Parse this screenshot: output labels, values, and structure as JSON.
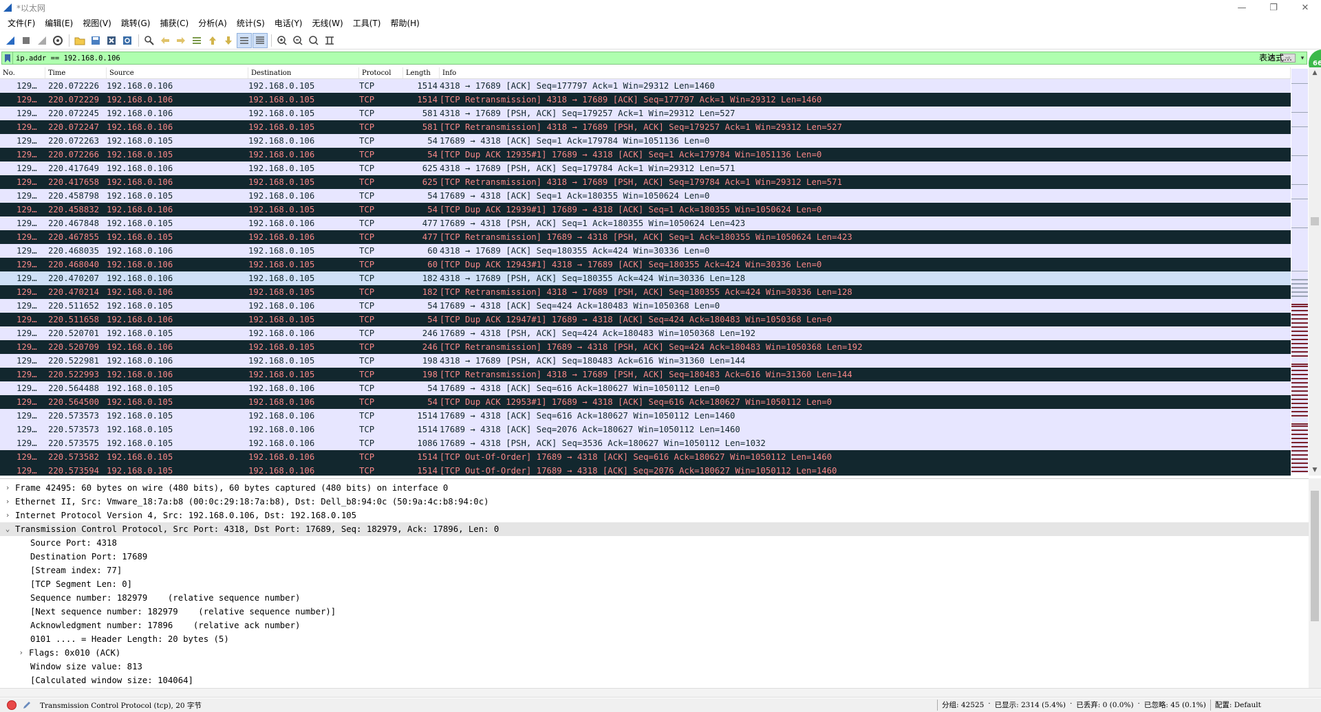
{
  "window": {
    "title": "*以太网",
    "minimize": "—",
    "restore": "❐",
    "close": "✕"
  },
  "menu": [
    "文件(F)",
    "编辑(E)",
    "视图(V)",
    "跳转(G)",
    "捕获(C)",
    "分析(A)",
    "统计(S)",
    "电话(Y)",
    "无线(W)",
    "工具(T)",
    "帮助(H)"
  ],
  "toolbar": {
    "icons": [
      "shark-fin-start-icon",
      "stop-square-icon",
      "restart-fin-icon",
      "capture-options-gear-icon",
      "open-folder-icon",
      "save-file-icon",
      "close-file-x-icon",
      "reload-icon",
      "find-magnifier-icon",
      "go-back-arrow-icon",
      "go-forward-arrow-icon",
      "go-to-packet-icon",
      "first-packet-icon",
      "last-packet-icon",
      "autoscroll-icon",
      "colorize-icon",
      "zoom-in-icon",
      "zoom-out-icon",
      "zoom-normal-icon",
      "resize-columns-icon"
    ]
  },
  "filter": {
    "value": "ip.addr == 192.168.0.106",
    "expression_label": "表达式…",
    "badge": "66"
  },
  "packet_list": {
    "columns": [
      "No.",
      "Time",
      "Source",
      "Destination",
      "Protocol",
      "Length",
      "Info"
    ],
    "rows": [
      {
        "no": "129…",
        "time": "220.072226",
        "src": "192.168.0.106",
        "dst": "192.168.0.105",
        "proto": "TCP",
        "len": "1514",
        "info": "4318 → 17689 [ACK] Seq=177797 Ack=1 Win=29312 Len=1460",
        "style": "normal"
      },
      {
        "no": "129…",
        "time": "220.072229",
        "src": "192.168.0.106",
        "dst": "192.168.0.105",
        "proto": "TCP",
        "len": "1514",
        "info": "[TCP Retransmission] 4318 → 17689 [ACK] Seq=177797 Ack=1 Win=29312 Len=1460",
        "style": "bad"
      },
      {
        "no": "129…",
        "time": "220.072245",
        "src": "192.168.0.106",
        "dst": "192.168.0.105",
        "proto": "TCP",
        "len": "581",
        "info": "4318 → 17689 [PSH, ACK] Seq=179257 Ack=1 Win=29312 Len=527",
        "style": "normal"
      },
      {
        "no": "129…",
        "time": "220.072247",
        "src": "192.168.0.106",
        "dst": "192.168.0.105",
        "proto": "TCP",
        "len": "581",
        "info": "[TCP Retransmission] 4318 → 17689 [PSH, ACK] Seq=179257 Ack=1 Win=29312 Len=527",
        "style": "bad"
      },
      {
        "no": "129…",
        "time": "220.072263",
        "src": "192.168.0.105",
        "dst": "192.168.0.106",
        "proto": "TCP",
        "len": "54",
        "info": "17689 → 4318 [ACK] Seq=1 Ack=179784 Win=1051136 Len=0",
        "style": "normal"
      },
      {
        "no": "129…",
        "time": "220.072266",
        "src": "192.168.0.105",
        "dst": "192.168.0.106",
        "proto": "TCP",
        "len": "54",
        "info": "[TCP Dup ACK 12935#1] 17689 → 4318 [ACK] Seq=1 Ack=179784 Win=1051136 Len=0",
        "style": "bad"
      },
      {
        "no": "129…",
        "time": "220.417649",
        "src": "192.168.0.106",
        "dst": "192.168.0.105",
        "proto": "TCP",
        "len": "625",
        "info": "4318 → 17689 [PSH, ACK] Seq=179784 Ack=1 Win=29312 Len=571",
        "style": "normal"
      },
      {
        "no": "129…",
        "time": "220.417658",
        "src": "192.168.0.106",
        "dst": "192.168.0.105",
        "proto": "TCP",
        "len": "625",
        "info": "[TCP Retransmission] 4318 → 17689 [PSH, ACK] Seq=179784 Ack=1 Win=29312 Len=571",
        "style": "bad"
      },
      {
        "no": "129…",
        "time": "220.458798",
        "src": "192.168.0.105",
        "dst": "192.168.0.106",
        "proto": "TCP",
        "len": "54",
        "info": "17689 → 4318 [ACK] Seq=1 Ack=180355 Win=1050624 Len=0",
        "style": "normal"
      },
      {
        "no": "129…",
        "time": "220.458832",
        "src": "192.168.0.106",
        "dst": "192.168.0.105",
        "proto": "TCP",
        "len": "54",
        "info": "[TCP Dup ACK 12939#1] 17689 → 4318 [ACK] Seq=1 Ack=180355 Win=1050624 Len=0",
        "style": "bad"
      },
      {
        "no": "129…",
        "time": "220.467848",
        "src": "192.168.0.105",
        "dst": "192.168.0.106",
        "proto": "TCP",
        "len": "477",
        "info": "17689 → 4318 [PSH, ACK] Seq=1 Ack=180355 Win=1050624 Len=423",
        "style": "normal"
      },
      {
        "no": "129…",
        "time": "220.467855",
        "src": "192.168.0.105",
        "dst": "192.168.0.106",
        "proto": "TCP",
        "len": "477",
        "info": "[TCP Retransmission] 17689 → 4318 [PSH, ACK] Seq=1 Ack=180355 Win=1050624 Len=423",
        "style": "bad"
      },
      {
        "no": "129…",
        "time": "220.468035",
        "src": "192.168.0.106",
        "dst": "192.168.0.105",
        "proto": "TCP",
        "len": "60",
        "info": "4318 → 17689 [ACK] Seq=180355 Ack=424 Win=30336 Len=0",
        "style": "normal"
      },
      {
        "no": "129…",
        "time": "220.468040",
        "src": "192.168.0.106",
        "dst": "192.168.0.105",
        "proto": "TCP",
        "len": "60",
        "info": "[TCP Dup ACK 12943#1] 4318 → 17689 [ACK] Seq=180355 Ack=424 Win=30336 Len=0",
        "style": "bad"
      },
      {
        "no": "129…",
        "time": "220.470207",
        "src": "192.168.0.106",
        "dst": "192.168.0.105",
        "proto": "TCP",
        "len": "182",
        "info": "4318 → 17689 [PSH, ACK] Seq=180355 Ack=424 Win=30336 Len=128",
        "style": "normal sel"
      },
      {
        "no": "129…",
        "time": "220.470214",
        "src": "192.168.0.106",
        "dst": "192.168.0.105",
        "proto": "TCP",
        "len": "182",
        "info": "[TCP Retransmission] 4318 → 17689 [PSH, ACK] Seq=180355 Ack=424 Win=30336 Len=128",
        "style": "bad"
      },
      {
        "no": "129…",
        "time": "220.511652",
        "src": "192.168.0.105",
        "dst": "192.168.0.106",
        "proto": "TCP",
        "len": "54",
        "info": "17689 → 4318 [ACK] Seq=424 Ack=180483 Win=1050368 Len=0",
        "style": "normal"
      },
      {
        "no": "129…",
        "time": "220.511658",
        "src": "192.168.0.106",
        "dst": "192.168.0.105",
        "proto": "TCP",
        "len": "54",
        "info": "[TCP Dup ACK 12947#1] 17689 → 4318 [ACK] Seq=424 Ack=180483 Win=1050368 Len=0",
        "style": "bad"
      },
      {
        "no": "129…",
        "time": "220.520701",
        "src": "192.168.0.105",
        "dst": "192.168.0.106",
        "proto": "TCP",
        "len": "246",
        "info": "17689 → 4318 [PSH, ACK] Seq=424 Ack=180483 Win=1050368 Len=192",
        "style": "normal"
      },
      {
        "no": "129…",
        "time": "220.520709",
        "src": "192.168.0.106",
        "dst": "192.168.0.105",
        "proto": "TCP",
        "len": "246",
        "info": "[TCP Retransmission] 17689 → 4318 [PSH, ACK] Seq=424 Ack=180483 Win=1050368 Len=192",
        "style": "bad"
      },
      {
        "no": "129…",
        "time": "220.522981",
        "src": "192.168.0.106",
        "dst": "192.168.0.105",
        "proto": "TCP",
        "len": "198",
        "info": "4318 → 17689 [PSH, ACK] Seq=180483 Ack=616 Win=31360 Len=144",
        "style": "normal"
      },
      {
        "no": "129…",
        "time": "220.522993",
        "src": "192.168.0.106",
        "dst": "192.168.0.105",
        "proto": "TCP",
        "len": "198",
        "info": "[TCP Retransmission] 4318 → 17689 [PSH, ACK] Seq=180483 Ack=616 Win=31360 Len=144",
        "style": "bad"
      },
      {
        "no": "129…",
        "time": "220.564488",
        "src": "192.168.0.105",
        "dst": "192.168.0.106",
        "proto": "TCP",
        "len": "54",
        "info": "17689 → 4318 [ACK] Seq=616 Ack=180627 Win=1050112 Len=0",
        "style": "normal"
      },
      {
        "no": "129…",
        "time": "220.564500",
        "src": "192.168.0.105",
        "dst": "192.168.0.106",
        "proto": "TCP",
        "len": "54",
        "info": "[TCP Dup ACK 12953#1] 17689 → 4318 [ACK] Seq=616 Ack=180627 Win=1050112 Len=0",
        "style": "bad"
      },
      {
        "no": "129…",
        "time": "220.573573",
        "src": "192.168.0.105",
        "dst": "192.168.0.106",
        "proto": "TCP",
        "len": "1514",
        "info": "17689 → 4318 [ACK] Seq=616 Ack=180627 Win=1050112 Len=1460",
        "style": "normal"
      },
      {
        "no": "129…",
        "time": "220.573573",
        "src": "192.168.0.105",
        "dst": "192.168.0.106",
        "proto": "TCP",
        "len": "1514",
        "info": "17689 → 4318 [ACK] Seq=2076 Ack=180627 Win=1050112 Len=1460",
        "style": "normal"
      },
      {
        "no": "129…",
        "time": "220.573575",
        "src": "192.168.0.105",
        "dst": "192.168.0.106",
        "proto": "TCP",
        "len": "1086",
        "info": "17689 → 4318 [PSH, ACK] Seq=3536 Ack=180627 Win=1050112 Len=1032",
        "style": "normal"
      },
      {
        "no": "129…",
        "time": "220.573582",
        "src": "192.168.0.105",
        "dst": "192.168.0.106",
        "proto": "TCP",
        "len": "1514",
        "info": "[TCP Out-Of-Order] 17689 → 4318 [ACK] Seq=616 Ack=180627 Win=1050112 Len=1460",
        "style": "bad"
      },
      {
        "no": "129…",
        "time": "220.573594",
        "src": "192.168.0.105",
        "dst": "192.168.0.106",
        "proto": "TCP",
        "len": "1514",
        "info": "[TCP Out-Of-Order] 17689 → 4318 [ACK] Seq=2076 Ack=180627 Win=1050112 Len=1460",
        "style": "bad"
      }
    ]
  },
  "detail": {
    "rows": [
      {
        "text": "Frame 42495: 60 bytes on wire (480 bits), 60 bytes captured (480 bits) on interface 0",
        "level": 0,
        "arrow": "›"
      },
      {
        "text": "Ethernet II, Src: Vmware_18:7a:b8 (00:0c:29:18:7a:b8), Dst: Dell_b8:94:0c (50:9a:4c:b8:94:0c)",
        "level": 0,
        "arrow": "›"
      },
      {
        "text": "Internet Protocol Version 4, Src: 192.168.0.106, Dst: 192.168.0.105",
        "level": 0,
        "arrow": "›"
      },
      {
        "text": "Transmission Control Protocol, Src Port: 4318, Dst Port: 17689, Seq: 182979, Ack: 17896, Len: 0",
        "level": 0,
        "arrow": "⌄",
        "selected": true
      },
      {
        "text": "Source Port: 4318",
        "level": 1,
        "arrow": ""
      },
      {
        "text": "Destination Port: 17689",
        "level": 1,
        "arrow": ""
      },
      {
        "text": "[Stream index: 77]",
        "level": 1,
        "arrow": ""
      },
      {
        "text": "[TCP Segment Len: 0]",
        "level": 1,
        "arrow": ""
      },
      {
        "text": "Sequence number: 182979    (relative sequence number)",
        "level": 1,
        "arrow": ""
      },
      {
        "text": "[Next sequence number: 182979    (relative sequence number)]",
        "level": 1,
        "arrow": ""
      },
      {
        "text": "Acknowledgment number: 17896    (relative ack number)",
        "level": 1,
        "arrow": ""
      },
      {
        "text": "0101 .... = Header Length: 20 bytes (5)",
        "level": 1,
        "arrow": ""
      },
      {
        "text": "Flags: 0x010 (ACK)",
        "level": 1,
        "arrow": "›"
      },
      {
        "text": "Window size value: 813",
        "level": 1,
        "arrow": ""
      },
      {
        "text": "[Calculated window size: 104064]",
        "level": 1,
        "arrow": ""
      }
    ]
  },
  "status": {
    "left": "Transmission Control Protocol (tcp), 20 字节",
    "packets": "分组: 42525",
    "displayed": "已显示: 2314 (5.4%)",
    "dropped": "已丢弃: 0 (0.0%)",
    "ignored": "已忽略: 45 (0.1%)",
    "profile": "配置: Default"
  },
  "colors": {
    "normal_bg": "#e7e6ff",
    "normal_fg": "#12272e",
    "bad_bg": "#12272e",
    "bad_fg": "#f78787",
    "filter_ok": "#afffaf"
  }
}
